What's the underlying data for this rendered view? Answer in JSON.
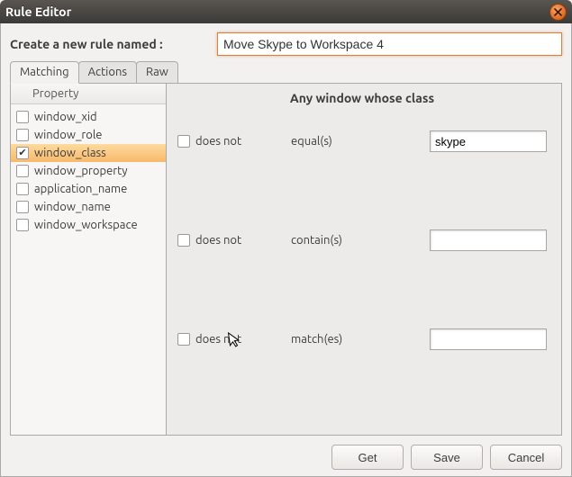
{
  "window": {
    "title": "Rule Editor"
  },
  "create_label": "Create a new rule named :",
  "rule_name": "Move Skype to Workspace 4",
  "tabs": [
    {
      "label": "Matching",
      "active": true
    },
    {
      "label": "Actions",
      "active": false
    },
    {
      "label": "Raw",
      "active": false
    }
  ],
  "sidebar": {
    "header": "Property",
    "items": [
      {
        "label": "window_xid",
        "checked": false,
        "selected": false
      },
      {
        "label": "window_role",
        "checked": false,
        "selected": false
      },
      {
        "label": "window_class",
        "checked": true,
        "selected": true
      },
      {
        "label": "window_property",
        "checked": false,
        "selected": false
      },
      {
        "label": "application_name",
        "checked": false,
        "selected": false
      },
      {
        "label": "window_name",
        "checked": false,
        "selected": false
      },
      {
        "label": "window_workspace",
        "checked": false,
        "selected": false
      }
    ]
  },
  "main": {
    "heading": "Any window whose class",
    "rows": [
      {
        "negate_label": "does not",
        "negate_checked": false,
        "op": "equal(s)",
        "value": "skype"
      },
      {
        "negate_label": "does not",
        "negate_checked": false,
        "op": "contain(s)",
        "value": ""
      },
      {
        "negate_label": "does not",
        "negate_checked": false,
        "op": "match(es)",
        "value": ""
      }
    ]
  },
  "buttons": {
    "get": "Get",
    "save": "Save",
    "cancel": "Cancel"
  }
}
